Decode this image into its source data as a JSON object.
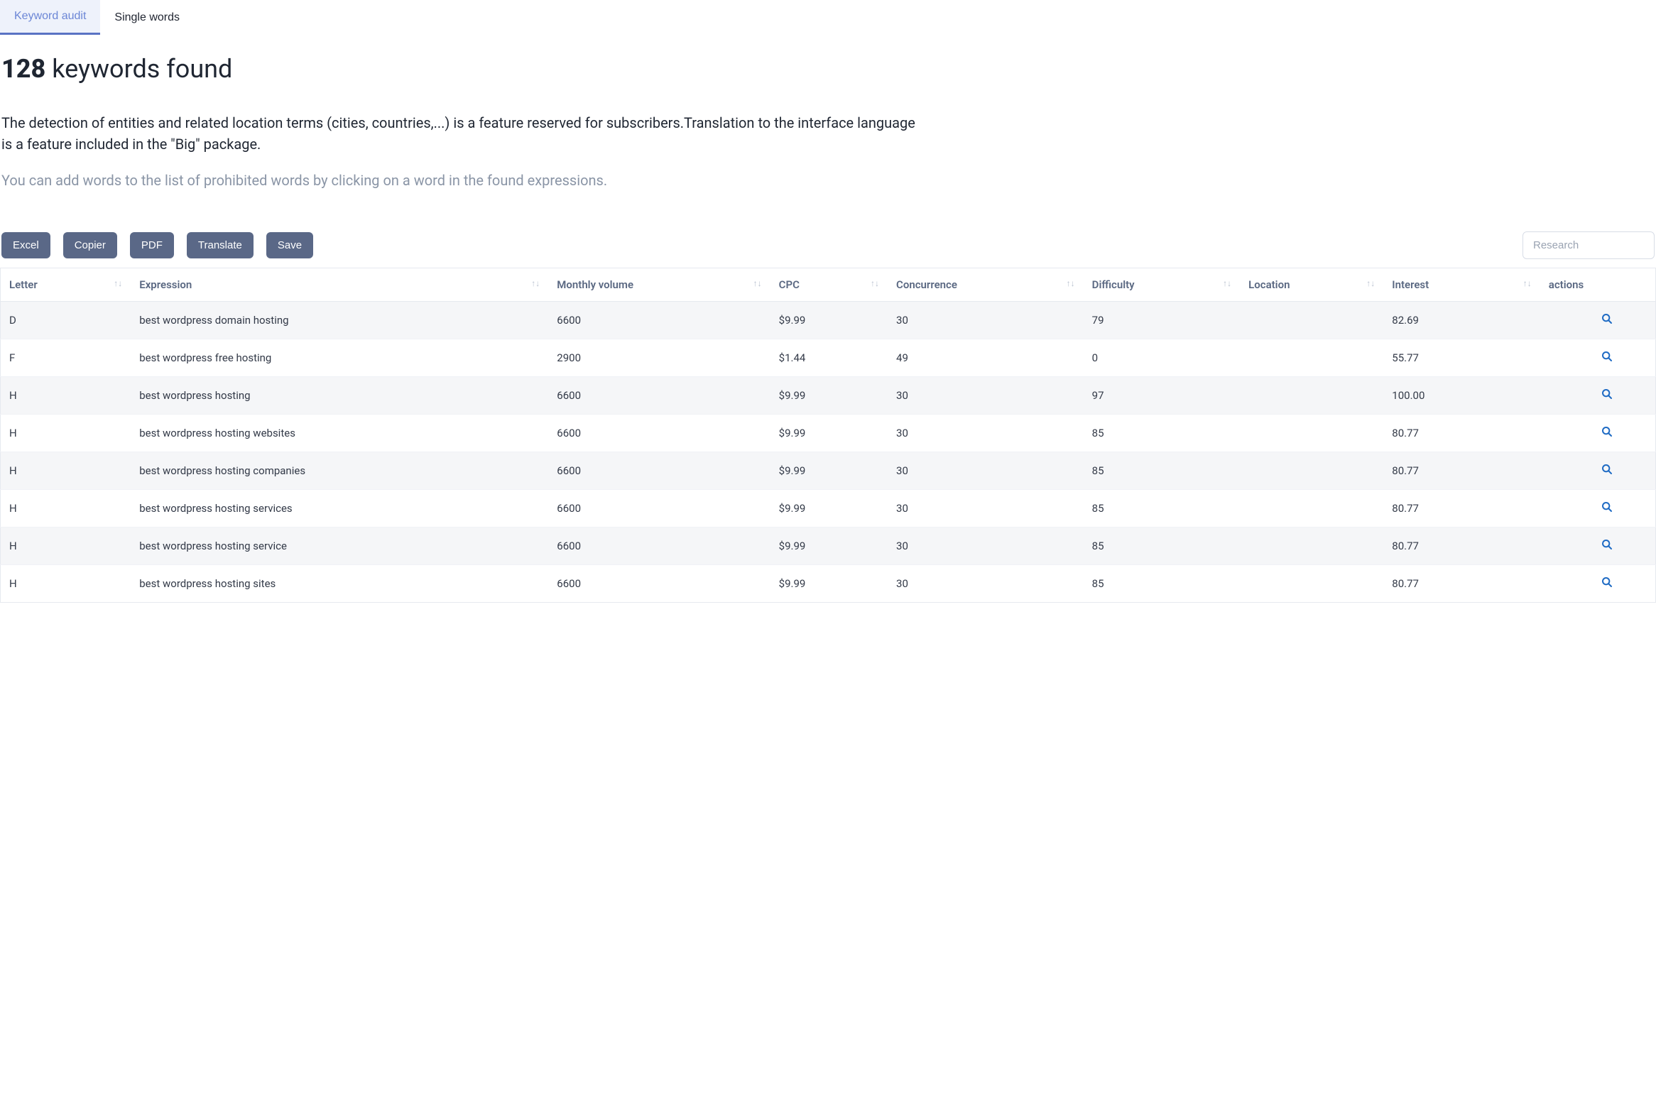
{
  "tabs": {
    "audit": "Keyword audit",
    "single": "Single words"
  },
  "title": {
    "count": "128",
    "rest": "keywords found"
  },
  "info_text": "The detection of entities and related location terms (cities, countries,...) is a feature reserved for subscribers.Translation to the interface language is a feature included in the \"Big\" package.",
  "hint_text": "You can add words to the list of prohibited words by clicking on a word in the found expressions.",
  "buttons": {
    "excel": "Excel",
    "copier": "Copier",
    "pdf": "PDF",
    "translate": "Translate",
    "save": "Save"
  },
  "search": {
    "placeholder": "Research"
  },
  "columns": {
    "letter": "Letter",
    "expression": "Expression",
    "volume": "Monthly volume",
    "cpc": "CPC",
    "concurrence": "Concurrence",
    "difficulty": "Difficulty",
    "location": "Location",
    "interest": "Interest",
    "actions": "actions"
  },
  "rows": [
    {
      "letter": "D",
      "expression": "best wordpress domain hosting",
      "volume": "6600",
      "cpc": "$9.99",
      "concurrence": "30",
      "difficulty": "79",
      "location": "",
      "interest": "82.69"
    },
    {
      "letter": "F",
      "expression": "best wordpress free hosting",
      "volume": "2900",
      "cpc": "$1.44",
      "concurrence": "49",
      "difficulty": "0",
      "location": "",
      "interest": "55.77"
    },
    {
      "letter": "H",
      "expression": "best wordpress hosting",
      "volume": "6600",
      "cpc": "$9.99",
      "concurrence": "30",
      "difficulty": "97",
      "location": "",
      "interest": "100.00"
    },
    {
      "letter": "H",
      "expression": "best wordpress hosting websites",
      "volume": "6600",
      "cpc": "$9.99",
      "concurrence": "30",
      "difficulty": "85",
      "location": "",
      "interest": "80.77"
    },
    {
      "letter": "H",
      "expression": "best wordpress hosting companies",
      "volume": "6600",
      "cpc": "$9.99",
      "concurrence": "30",
      "difficulty": "85",
      "location": "",
      "interest": "80.77"
    },
    {
      "letter": "H",
      "expression": "best wordpress hosting services",
      "volume": "6600",
      "cpc": "$9.99",
      "concurrence": "30",
      "difficulty": "85",
      "location": "",
      "interest": "80.77"
    },
    {
      "letter": "H",
      "expression": "best wordpress hosting service",
      "volume": "6600",
      "cpc": "$9.99",
      "concurrence": "30",
      "difficulty": "85",
      "location": "",
      "interest": "80.77"
    },
    {
      "letter": "H",
      "expression": "best wordpress hosting sites",
      "volume": "6600",
      "cpc": "$9.99",
      "concurrence": "30",
      "difficulty": "85",
      "location": "",
      "interest": "80.77"
    }
  ]
}
